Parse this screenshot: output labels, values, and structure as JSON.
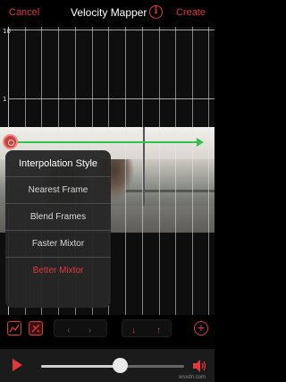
{
  "header": {
    "cancel_label": "Cancel",
    "title": "Velocity Mapper",
    "info_icon": "i",
    "create_label": "Create"
  },
  "graph": {
    "y_axis_labels": [
      "10",
      "1"
    ],
    "speed_line_color": "#34c24b"
  },
  "interpolation_menu": {
    "title": "Interpolation Style",
    "options": [
      {
        "label": "Nearest Frame",
        "selected": false
      },
      {
        "label": "Blend Frames",
        "selected": false
      },
      {
        "label": "Faster Mixtor",
        "selected": false
      },
      {
        "label": "Better Mixtor",
        "selected": true
      }
    ]
  },
  "toolbar": {
    "left_arrow": "‹",
    "right_arrow": "›",
    "down_arrow": "↓",
    "up_arrow": "↑",
    "add": "+"
  },
  "playback": {
    "progress": 0.55,
    "watermark": "wsxdn.com"
  },
  "colors": {
    "accent": "#e0383e",
    "background": "#000000",
    "popup": "#262626"
  }
}
